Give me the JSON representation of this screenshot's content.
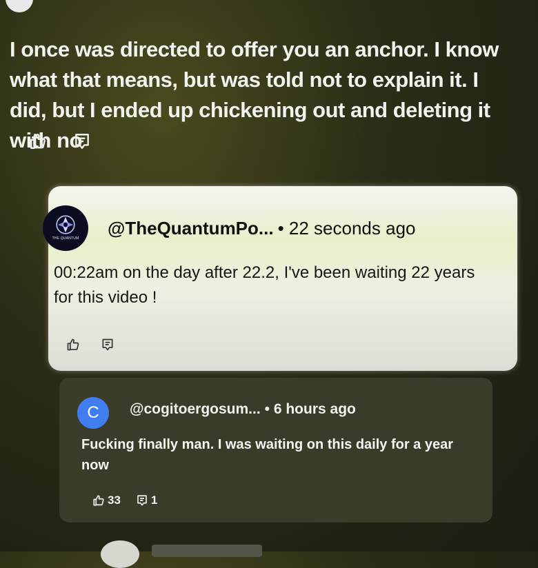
{
  "top_comment": {
    "text": "I once was directed to offer you an anchor. I know what that means, but was told not to explain it. I did, but I ended up chickening out and deleting it with no",
    "like_icon": "thumbs-up-icon",
    "reply_icon": "reply-icon"
  },
  "reply_quantum": {
    "handle": "@TheQuantumPo...",
    "time": "• 22 seconds ago",
    "avatar_text": "THE QUANTUM",
    "text": "00:22am on the day after 22.2, I've been waiting 22 years for this video !",
    "like_icon": "thumbs-up-icon",
    "reply_icon": "reply-icon"
  },
  "reply_cogito": {
    "avatar_letter": "C",
    "avatar_color": "#3f7df1",
    "handle": "@cogitoergosum...",
    "time": "• 6 hours ago",
    "text": "Fucking finally man. I was waiting on this daily for a year now",
    "likes": "33",
    "replies": "1"
  }
}
